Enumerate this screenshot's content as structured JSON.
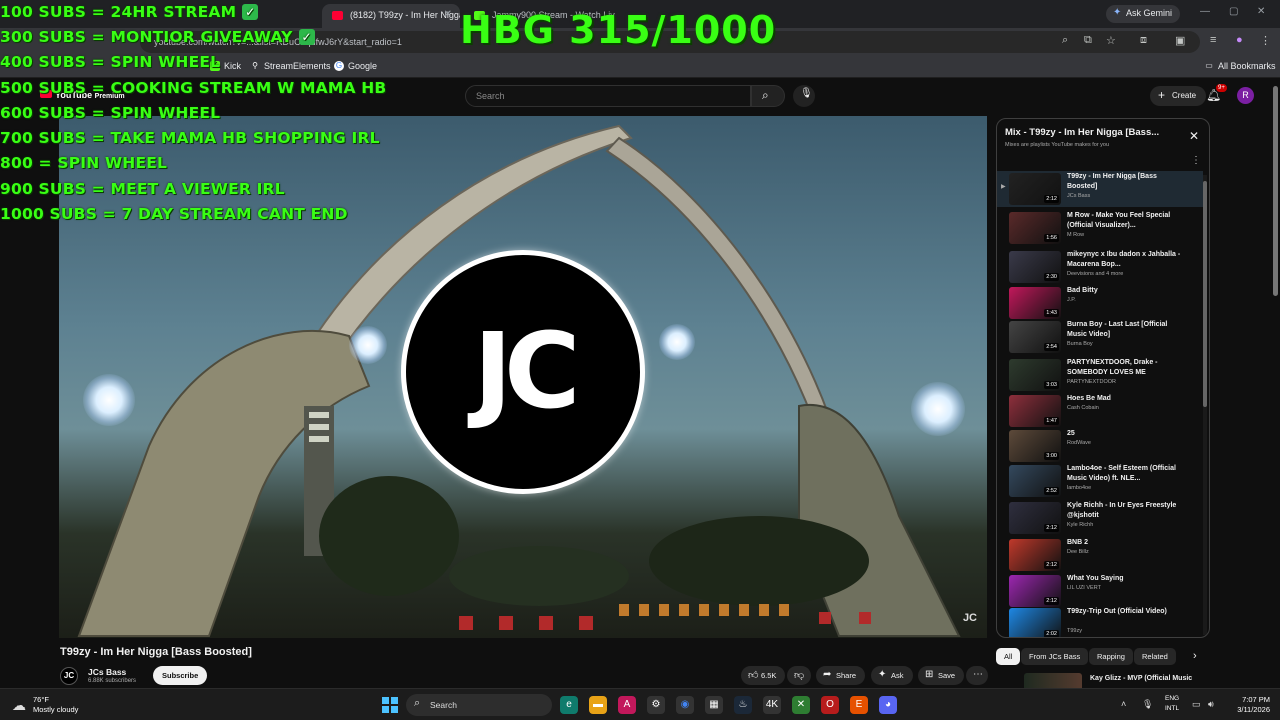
{
  "browser": {
    "tabs": [
      {
        "label": "(8182) T99zy - Im Her Nigga [B",
        "active": true,
        "favicon_color": "#ff0033"
      },
      {
        "label": "Jammy900 Stream - Watch Liv",
        "active": false,
        "favicon_color": "#53fc18"
      }
    ],
    "gemini_label": "Ask Gemini",
    "url": "youtube.com/watch?v=...&list=RDuC1qufwJ6rY&start_radio=1",
    "bookmarks": [
      {
        "label": "Kick",
        "icon": "kick-icon",
        "color": "#53fc18"
      },
      {
        "label": "StreamElements",
        "icon": "streamelements-icon",
        "color": "#ffffff"
      },
      {
        "label": "Google",
        "icon": "google-icon",
        "color": "#4285f4"
      }
    ],
    "all_bookmarks": "All Bookmarks"
  },
  "youtube": {
    "logo_suffix": "Premium",
    "search_placeholder": "Search",
    "create_label": "Create",
    "notif_count": "9+",
    "avatar_letter": "R"
  },
  "overlay": {
    "goals": [
      {
        "text": "100 SUBS = 24HR STREAM",
        "checked": true
      },
      {
        "text": "300 SUBS = MONTIOR GIVEAWAY",
        "checked": true
      },
      {
        "text": "400 SUBS = SPIN WHEEL",
        "checked": false
      },
      {
        "text": "500 SUBS = COOKING STREAM W MAMA HB",
        "checked": false
      },
      {
        "text": "600 SUBS = SPIN WHEEL",
        "checked": false
      },
      {
        "text": "700 SUBS = TAKE MAMA HB SHOPPING IRL",
        "checked": false
      },
      {
        "text": "800 = SPIN WHEEL",
        "checked": false
      },
      {
        "text": "900 SUBS =  MEET A VIEWER IRL",
        "checked": false
      },
      {
        "text": "1000 SUBS = 7 DAY STREAM CANT END",
        "checked": false
      }
    ],
    "counter": "HBG 315/1000",
    "accent": "#39ff14"
  },
  "video": {
    "logo_text": "JC",
    "watermark": "JC",
    "title": "T99zy - Im Her Nigga [Bass Boosted]",
    "channel": "JCs Bass",
    "subscribers": "6.88K subscribers",
    "subscribe_label": "Subscribe",
    "likes": "6.5K",
    "share_label": "Share",
    "ask_label": "Ask",
    "save_label": "Save"
  },
  "playlist": {
    "title": "Mix - T99zy - Im Her Nigga [Bass...",
    "subtitle": "Mixes are playlists YouTube makes for you",
    "items": [
      {
        "title": "T99zy - Im Her Nigga [Bass Boosted]",
        "channel": "JCs Bass",
        "duration": "2:12",
        "thumb": "#222222",
        "current": true
      },
      {
        "title": "M Row - Make You Feel Special (Official Visualizer)...",
        "channel": "M Row",
        "duration": "1:56",
        "thumb": "#5a2a2a",
        "current": false
      },
      {
        "title": "mikeynyc x Ibu dadon x Jahballa - Macarena Bop...",
        "channel": "Deevisions  and 4 more",
        "duration": "2:30",
        "thumb": "#3a3a4a",
        "current": false
      },
      {
        "title": "Bad Bitty",
        "channel": "J.P.",
        "duration": "1:43",
        "thumb": "#c2185b",
        "current": false
      },
      {
        "title": "Burna Boy - Last Last [Official Music Video]",
        "channel": "Burna Boy",
        "duration": "2:54",
        "thumb": "#444444",
        "current": false
      },
      {
        "title": "PARTYNEXTDOOR, Drake - SOMEBODY LOVES ME",
        "channel": "PARTYNEXTDOOR",
        "duration": "3:03",
        "thumb": "#2e3b2e",
        "current": false
      },
      {
        "title": "Hoes Be Mad",
        "channel": "Cash Cobain",
        "duration": "1:47",
        "thumb": "#8e2f3c",
        "current": false
      },
      {
        "title": "25",
        "channel": "RodWave",
        "duration": "3:00",
        "thumb": "#5d4a3a",
        "current": false
      },
      {
        "title": "Lambo4oe - Self Esteem (Official Music Video) ft. NLE...",
        "channel": "lambo4oe",
        "duration": "2:52",
        "thumb": "#34495e",
        "current": false
      },
      {
        "title": "Kyle Richh - In Ur Eyes Freestyle @kjshotit",
        "channel": "Kyle Richh",
        "duration": "2:12",
        "thumb": "#2f2f3f",
        "current": false
      },
      {
        "title": "BNB 2",
        "channel": "Dee Billz",
        "duration": "2:12",
        "thumb": "#c0392b",
        "current": false
      },
      {
        "title": "What You Saying",
        "channel": "LIL UZI VERT",
        "duration": "2:12",
        "thumb": "#9c27b0",
        "current": false
      },
      {
        "title": "T99zy-Trip Out (Official Video)",
        "channel": "T99zy",
        "duration": "2:02",
        "thumb": "#1e88e5",
        "current": false
      }
    ]
  },
  "chips": [
    "All",
    "From JCs Bass",
    "Rapping",
    "Related"
  ],
  "below_rec_title": "Kay Glizz - MVP (Official Music",
  "taskbar": {
    "temperature": "76°F",
    "weather": "Mostly cloudy",
    "search_label": "Search",
    "lang1": "ENG",
    "lang2": "INTL",
    "time": "7:07 PM",
    "date": "3/11/2026"
  }
}
